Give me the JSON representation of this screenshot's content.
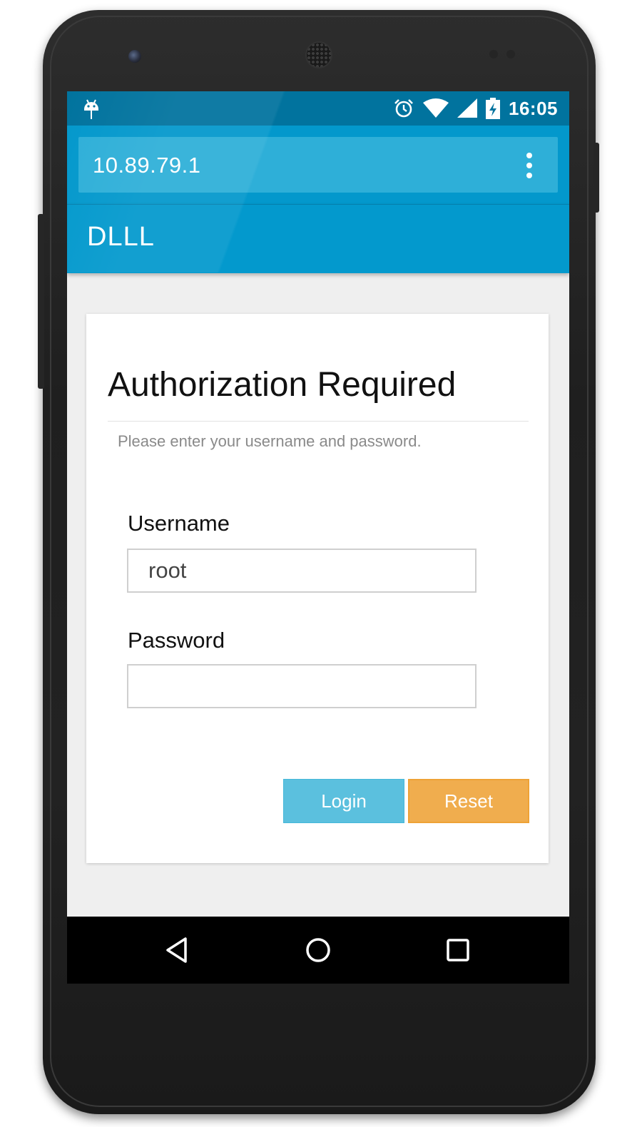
{
  "status_bar": {
    "time": "16:05",
    "icons": [
      "android-icon",
      "alarm-icon",
      "wifi-icon",
      "signal-icon",
      "battery-charging-icon"
    ]
  },
  "browser": {
    "url": "10.89.79.1",
    "menu_icon": "overflow-menu-icon"
  },
  "app_bar": {
    "title": "DLLL"
  },
  "login": {
    "heading": "Authorization Required",
    "subtitle": "Please enter your username and password.",
    "username_label": "Username",
    "username_value": "root",
    "password_label": "Password",
    "password_value": "",
    "login_label": "Login",
    "reset_label": "Reset"
  },
  "colors": {
    "status_bar": "#01739e",
    "toolbar": "#0399cd",
    "login_button": "#5bc0de",
    "reset_button": "#f0ad4e"
  },
  "nav_bar": {
    "icons": [
      "back-icon",
      "home-icon",
      "recent-apps-icon"
    ]
  }
}
